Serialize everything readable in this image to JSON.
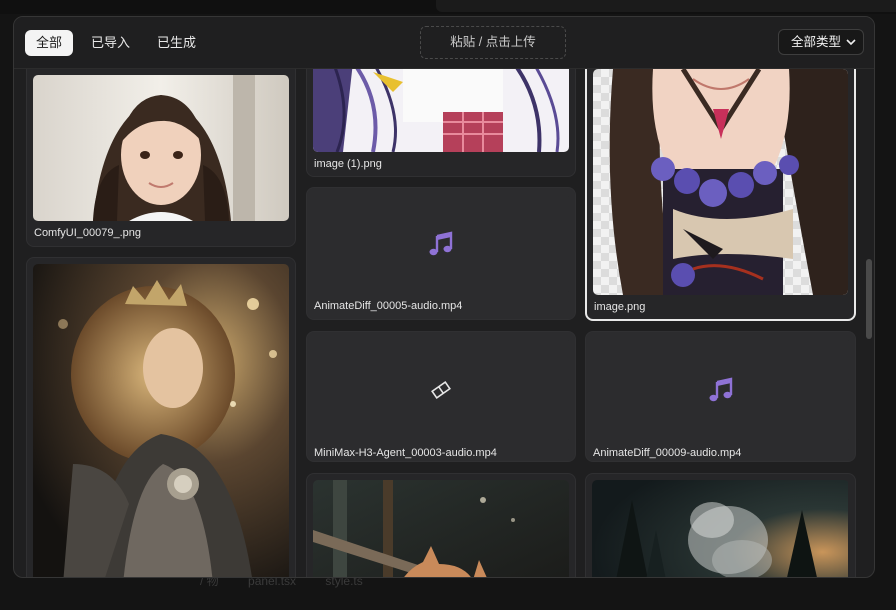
{
  "tabs": [
    {
      "label": "全部",
      "active": true
    },
    {
      "label": "已导入",
      "active": false
    },
    {
      "label": "已生成",
      "active": false
    }
  ],
  "upload_label": "粘贴 / 点击上传",
  "filter": {
    "selected": "全部类型"
  },
  "background_text": [
    "/ 物",
    "panel.tsx",
    "style.ts"
  ],
  "cards": [
    {
      "name": "ComfyUI_00079_.png",
      "type": "image",
      "subject": "portrait-girl"
    },
    {
      "name": "",
      "type": "image",
      "subject": "armored-warrior"
    },
    {
      "name": "image (1).png",
      "type": "image",
      "subject": "anime-partial"
    },
    {
      "name": "AnimateDiff_00005-audio.mp4",
      "type": "audio",
      "icon": "music-note-icon"
    },
    {
      "name": "MiniMax-H3-Agent_00003-audio.mp4",
      "type": "video",
      "icon": "broken-file-icon"
    },
    {
      "name": "",
      "type": "image",
      "subject": "cat-scene"
    },
    {
      "name": "image.png",
      "type": "image",
      "subject": "anime-dress",
      "selected": true
    },
    {
      "name": "AnimateDiff_00009-audio.mp4",
      "type": "audio",
      "icon": "music-note-icon"
    },
    {
      "name": "",
      "type": "image",
      "subject": "forest-mist"
    }
  ],
  "colors": {
    "accent_icon": "#8f72d6",
    "panel_bg": "#1f1f20",
    "card_bg": "#262628",
    "selected_border": "#e9e9e9"
  }
}
